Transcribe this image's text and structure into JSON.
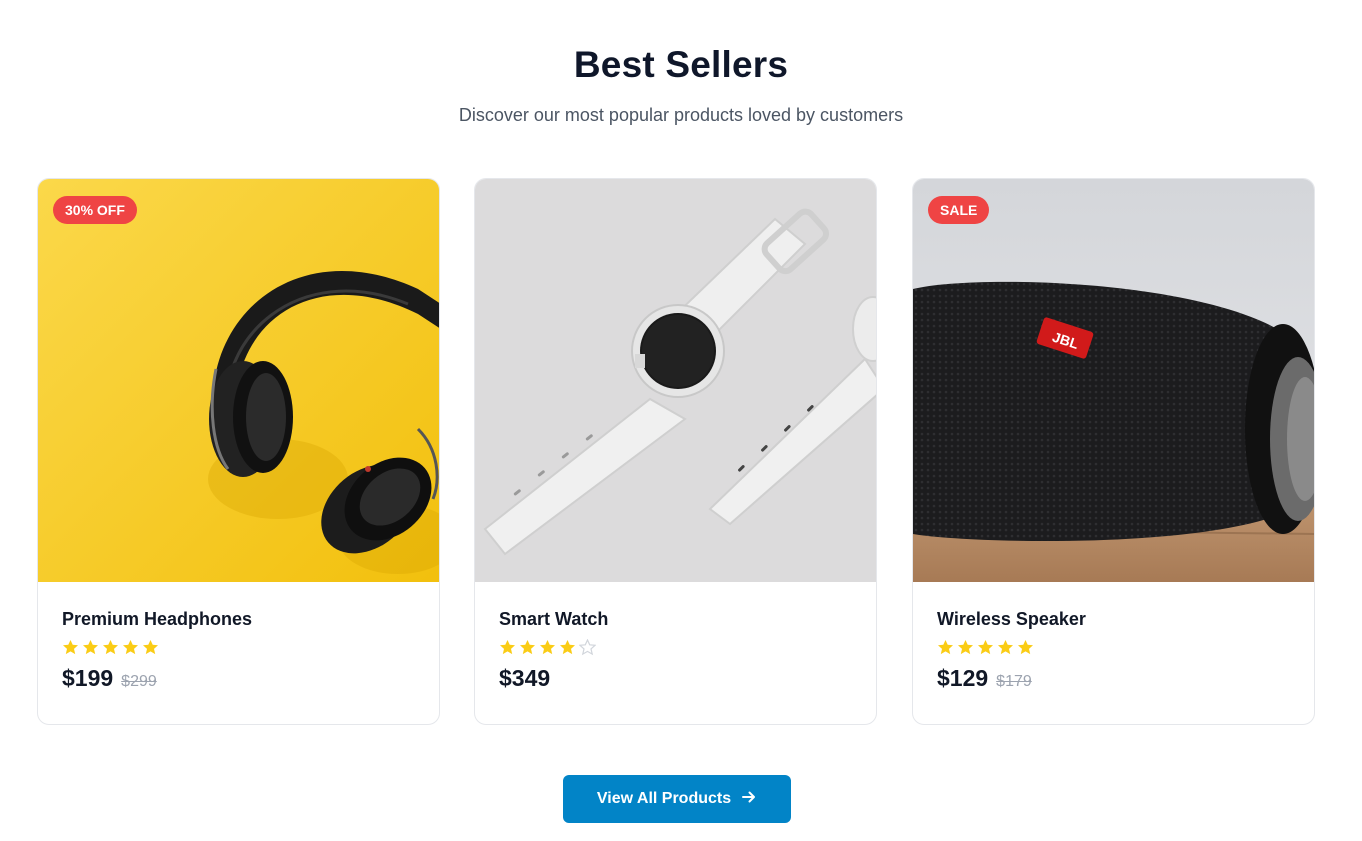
{
  "section": {
    "title": "Best Sellers",
    "subtitle": "Discover our most popular products loved by customers"
  },
  "products": [
    {
      "name": "Premium Headphones",
      "badge": "30% OFF",
      "rating": 5,
      "rating_max": 5,
      "price": "$199",
      "old_price": "$299",
      "image": "headphones-on-yellow"
    },
    {
      "name": "Smart Watch",
      "badge": "",
      "rating": 4,
      "rating_max": 5,
      "price": "$349",
      "old_price": "",
      "image": "white-smartwatch-on-grey"
    },
    {
      "name": "Wireless Speaker",
      "badge": "SALE",
      "rating": 5,
      "rating_max": 5,
      "price": "$129",
      "old_price": "$179",
      "image": "black-jbl-speaker-on-wood"
    }
  ],
  "cta": {
    "label": "View All Products",
    "icon": "arrow-right-icon"
  },
  "colors": {
    "badge": "#ef4444",
    "cta": "#0284c7",
    "star_filled": "#facc15",
    "star_empty": "#d1d5db"
  }
}
